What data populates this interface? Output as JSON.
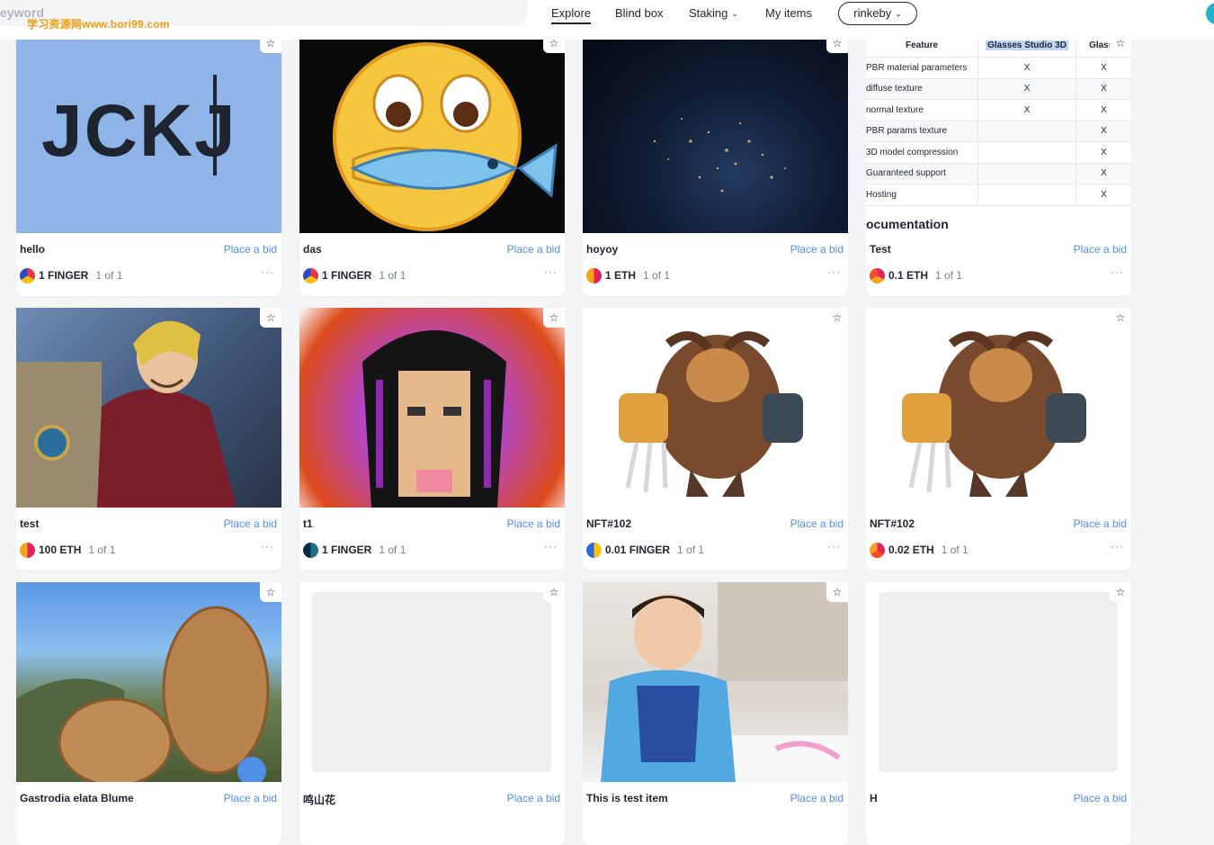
{
  "search": {
    "placeholder": "eyword"
  },
  "watermark": "学习资源网www.bori99.com",
  "nav": {
    "explore": "Explore",
    "blind_box": "Blind box",
    "staking": "Staking",
    "my_items": "My items",
    "network": "rinkeby"
  },
  "cards": [
    {
      "title": "hello",
      "bid": "Place a bid",
      "price": "1 FINGER",
      "edition": "1 of 1",
      "more": "···",
      "media": "jckj",
      "media_text": "JCKJ"
    },
    {
      "title": "das",
      "bid": "Place a bid",
      "price": "1 FINGER",
      "edition": "1 of 1",
      "more": "···",
      "media": "emoji"
    },
    {
      "title": "hoyoy",
      "bid": "Place a bid",
      "price": "1 ETH",
      "edition": "1 of 1",
      "more": "···",
      "media": "earth"
    },
    {
      "title": "Test",
      "bid": "Place a bid",
      "price": "0.1 ETH",
      "edition": "1 of 1",
      "more": "···",
      "media": "doc",
      "doc": {
        "headers": [
          "Feature",
          "Glasses Studio 3D",
          "Glasse"
        ],
        "rows": [
          [
            "PBR material parameters",
            "X",
            "X"
          ],
          [
            "diffuse texture",
            "X",
            "X"
          ],
          [
            "normal texture",
            "X",
            "X"
          ],
          [
            "PBR params texture",
            "",
            "X"
          ],
          [
            "3D model compression",
            "",
            "X"
          ],
          [
            "Guaranteed support",
            "",
            "X"
          ],
          [
            "Hosting",
            "",
            "X"
          ]
        ],
        "heading": "ocumentation"
      }
    },
    {
      "title": "test",
      "bid": "Place a bid",
      "price": "100 ETH",
      "edition": "1 of 1",
      "more": "···",
      "media": "anime"
    },
    {
      "title": "t1",
      "bid": "Place a bid",
      "price": "1 FINGER",
      "edition": "1 of 1",
      "more": "···",
      "media": "pixel"
    },
    {
      "title": "NFT#102",
      "bid": "Place a bid",
      "price": "0.01 FINGER",
      "edition": "1 of 1",
      "more": "···",
      "media": "warrior"
    },
    {
      "title": "NFT#102",
      "bid": "Place a bid",
      "price": "0.02 ETH",
      "edition": "1 of 1",
      "more": "···",
      "media": "warrior"
    },
    {
      "title": "Gastrodia elata Blume",
      "bid": "Place a bid",
      "media": "roots"
    },
    {
      "title": "鸣山花",
      "bid": "Place a bid",
      "media": "blank"
    },
    {
      "title": "This is test item",
      "bid": "Place a bid",
      "media": "child"
    },
    {
      "title": "H",
      "bid": "Place a bid",
      "media": "blank"
    }
  ],
  "colors": {
    "link": "#4f8fe8",
    "watermark": "#f39c12",
    "avatar": "#1fb5c9"
  }
}
